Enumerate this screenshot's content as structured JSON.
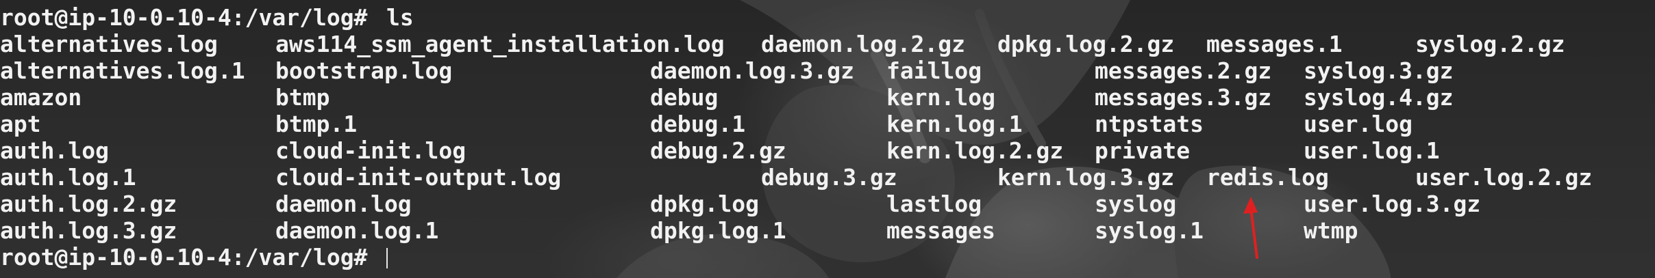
{
  "terminal": {
    "prompt": "root@ip-10-0-10-4:/var/log# ",
    "command": "ls",
    "rows": [
      [
        "alternatives.log",
        "aws114_ssm_agent_installation.log",
        "daemon.log.2.gz",
        "dpkg.log.2.gz",
        "messages.1",
        "syslog.2.gz"
      ],
      [
        "alternatives.log.1",
        "bootstrap.log",
        "daemon.log.3.gz",
        "faillog",
        "messages.2.gz",
        "syslog.3.gz"
      ],
      [
        "amazon",
        "btmp",
        "debug",
        "kern.log",
        "messages.3.gz",
        "syslog.4.gz"
      ],
      [
        "apt",
        "btmp.1",
        "debug.1",
        "kern.log.1",
        "ntpstats",
        "user.log"
      ],
      [
        "auth.log",
        "cloud-init.log",
        "debug.2.gz",
        "kern.log.2.gz",
        "private",
        "user.log.1"
      ],
      [
        "auth.log.1",
        "cloud-init-output.log",
        "debug.3.gz",
        "kern.log.3.gz",
        "redis.log",
        "user.log.2.gz"
      ],
      [
        "auth.log.2.gz",
        "daemon.log",
        "dpkg.log",
        "lastlog",
        "syslog",
        "user.log.3.gz"
      ],
      [
        "auth.log.3.gz",
        "daemon.log.1",
        "dpkg.log.1",
        "messages",
        "syslog.1",
        "wtmp"
      ]
    ]
  }
}
